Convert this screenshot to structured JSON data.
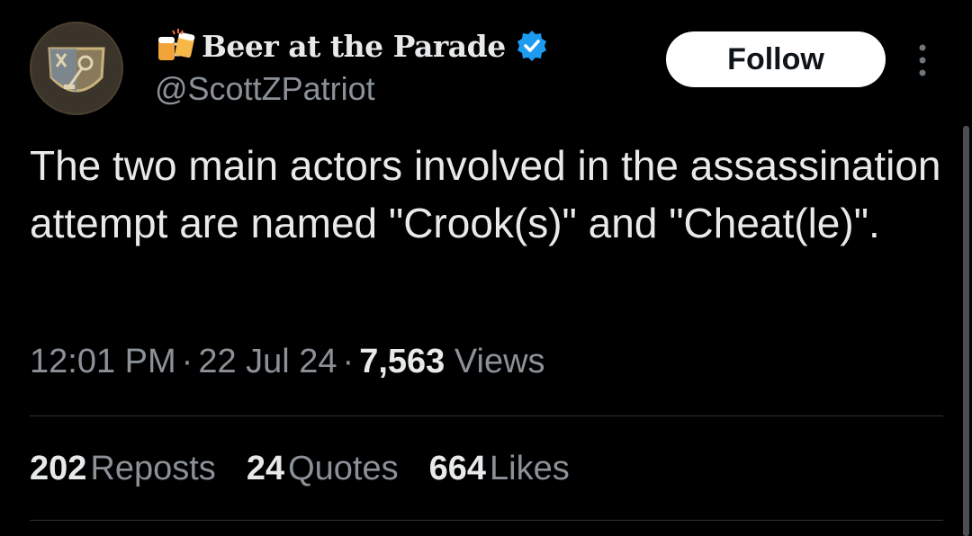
{
  "author": {
    "display_name": "Beer at the Parade",
    "handle": "@ScottZPatriot",
    "name_emoji": "beer-mugs-icon",
    "verified_badge": "verified-icon",
    "verified_color": "#1d9bf0"
  },
  "actions": {
    "follow_label": "Follow",
    "more_icon": "more-vertical-icon"
  },
  "tweet": {
    "text": "The two main actors involved in the assassination attempt are named \"Crook(s)\" and \"Cheat(le)\"."
  },
  "meta": {
    "time": "12:01 PM",
    "separator": "·",
    "date": "22 Jul 24",
    "views_count": "7,563",
    "views_label": "Views"
  },
  "stats": [
    {
      "count": "202",
      "label": "Reposts"
    },
    {
      "count": "24",
      "label": "Quotes"
    },
    {
      "count": "664",
      "label": "Likes"
    }
  ]
}
